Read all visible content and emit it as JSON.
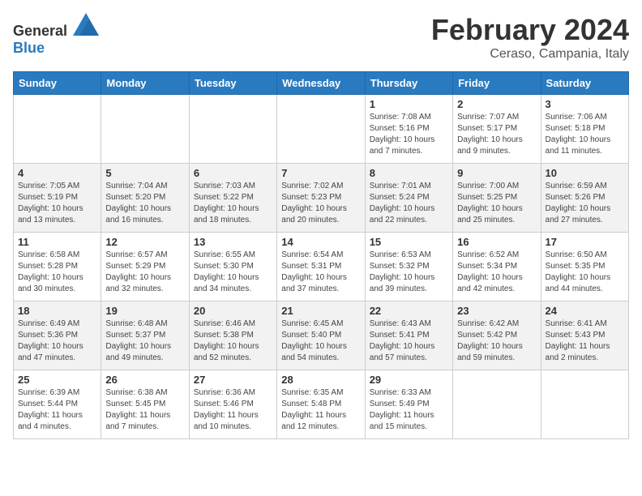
{
  "header": {
    "logo": {
      "text_general": "General",
      "text_blue": "Blue"
    },
    "title": "February 2024",
    "location": "Ceraso, Campania, Italy"
  },
  "calendar": {
    "days_of_week": [
      "Sunday",
      "Monday",
      "Tuesday",
      "Wednesday",
      "Thursday",
      "Friday",
      "Saturday"
    ],
    "weeks": [
      [
        {
          "day": "",
          "info": ""
        },
        {
          "day": "",
          "info": ""
        },
        {
          "day": "",
          "info": ""
        },
        {
          "day": "",
          "info": ""
        },
        {
          "day": "1",
          "info": "Sunrise: 7:08 AM\nSunset: 5:16 PM\nDaylight: 10 hours and 7 minutes."
        },
        {
          "day": "2",
          "info": "Sunrise: 7:07 AM\nSunset: 5:17 PM\nDaylight: 10 hours and 9 minutes."
        },
        {
          "day": "3",
          "info": "Sunrise: 7:06 AM\nSunset: 5:18 PM\nDaylight: 10 hours and 11 minutes."
        }
      ],
      [
        {
          "day": "4",
          "info": "Sunrise: 7:05 AM\nSunset: 5:19 PM\nDaylight: 10 hours and 13 minutes."
        },
        {
          "day": "5",
          "info": "Sunrise: 7:04 AM\nSunset: 5:20 PM\nDaylight: 10 hours and 16 minutes."
        },
        {
          "day": "6",
          "info": "Sunrise: 7:03 AM\nSunset: 5:22 PM\nDaylight: 10 hours and 18 minutes."
        },
        {
          "day": "7",
          "info": "Sunrise: 7:02 AM\nSunset: 5:23 PM\nDaylight: 10 hours and 20 minutes."
        },
        {
          "day": "8",
          "info": "Sunrise: 7:01 AM\nSunset: 5:24 PM\nDaylight: 10 hours and 22 minutes."
        },
        {
          "day": "9",
          "info": "Sunrise: 7:00 AM\nSunset: 5:25 PM\nDaylight: 10 hours and 25 minutes."
        },
        {
          "day": "10",
          "info": "Sunrise: 6:59 AM\nSunset: 5:26 PM\nDaylight: 10 hours and 27 minutes."
        }
      ],
      [
        {
          "day": "11",
          "info": "Sunrise: 6:58 AM\nSunset: 5:28 PM\nDaylight: 10 hours and 30 minutes."
        },
        {
          "day": "12",
          "info": "Sunrise: 6:57 AM\nSunset: 5:29 PM\nDaylight: 10 hours and 32 minutes."
        },
        {
          "day": "13",
          "info": "Sunrise: 6:55 AM\nSunset: 5:30 PM\nDaylight: 10 hours and 34 minutes."
        },
        {
          "day": "14",
          "info": "Sunrise: 6:54 AM\nSunset: 5:31 PM\nDaylight: 10 hours and 37 minutes."
        },
        {
          "day": "15",
          "info": "Sunrise: 6:53 AM\nSunset: 5:32 PM\nDaylight: 10 hours and 39 minutes."
        },
        {
          "day": "16",
          "info": "Sunrise: 6:52 AM\nSunset: 5:34 PM\nDaylight: 10 hours and 42 minutes."
        },
        {
          "day": "17",
          "info": "Sunrise: 6:50 AM\nSunset: 5:35 PM\nDaylight: 10 hours and 44 minutes."
        }
      ],
      [
        {
          "day": "18",
          "info": "Sunrise: 6:49 AM\nSunset: 5:36 PM\nDaylight: 10 hours and 47 minutes."
        },
        {
          "day": "19",
          "info": "Sunrise: 6:48 AM\nSunset: 5:37 PM\nDaylight: 10 hours and 49 minutes."
        },
        {
          "day": "20",
          "info": "Sunrise: 6:46 AM\nSunset: 5:38 PM\nDaylight: 10 hours and 52 minutes."
        },
        {
          "day": "21",
          "info": "Sunrise: 6:45 AM\nSunset: 5:40 PM\nDaylight: 10 hours and 54 minutes."
        },
        {
          "day": "22",
          "info": "Sunrise: 6:43 AM\nSunset: 5:41 PM\nDaylight: 10 hours and 57 minutes."
        },
        {
          "day": "23",
          "info": "Sunrise: 6:42 AM\nSunset: 5:42 PM\nDaylight: 10 hours and 59 minutes."
        },
        {
          "day": "24",
          "info": "Sunrise: 6:41 AM\nSunset: 5:43 PM\nDaylight: 11 hours and 2 minutes."
        }
      ],
      [
        {
          "day": "25",
          "info": "Sunrise: 6:39 AM\nSunset: 5:44 PM\nDaylight: 11 hours and 4 minutes."
        },
        {
          "day": "26",
          "info": "Sunrise: 6:38 AM\nSunset: 5:45 PM\nDaylight: 11 hours and 7 minutes."
        },
        {
          "day": "27",
          "info": "Sunrise: 6:36 AM\nSunset: 5:46 PM\nDaylight: 11 hours and 10 minutes."
        },
        {
          "day": "28",
          "info": "Sunrise: 6:35 AM\nSunset: 5:48 PM\nDaylight: 11 hours and 12 minutes."
        },
        {
          "day": "29",
          "info": "Sunrise: 6:33 AM\nSunset: 5:49 PM\nDaylight: 11 hours and 15 minutes."
        },
        {
          "day": "",
          "info": ""
        },
        {
          "day": "",
          "info": ""
        }
      ]
    ]
  }
}
